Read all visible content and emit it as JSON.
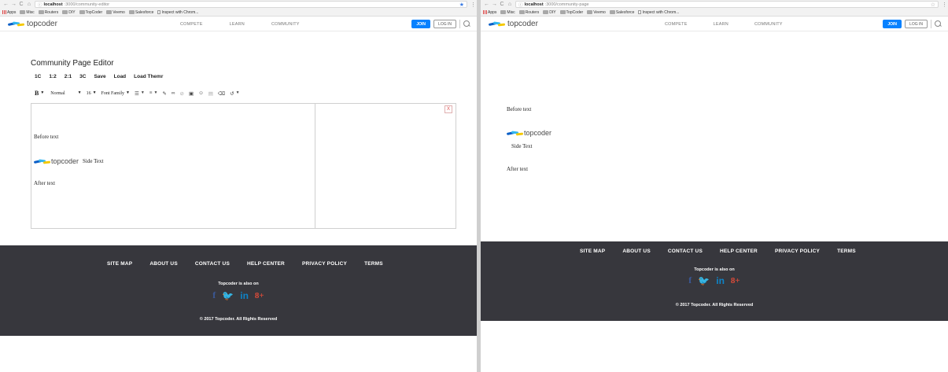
{
  "bookmarks": [
    "Apps",
    "Misc",
    "Routers",
    "DIY",
    "TopCoder",
    "Veemo",
    "Salesforce",
    "Inspect with Chrom..."
  ],
  "site": {
    "logo_text": "topcoder",
    "nav": [
      "COMPETE",
      "LEARN",
      "COMMUNITY"
    ],
    "join": "JOIN",
    "login": "LOG IN"
  },
  "left": {
    "url_host": "localhost",
    "url_path": ":3000/community-editor",
    "editor_title": "Community Page Editor",
    "layout_buttons": [
      "1C",
      "1:2",
      "2:1",
      "3C",
      "Save",
      "Load",
      "Load Themr"
    ],
    "format": {
      "bold": "B",
      "block_type": "Normal",
      "font_size": "16",
      "font_family": "Font Family"
    },
    "close_label": "X",
    "content": {
      "before": "Before text",
      "logo_text": "topcoder",
      "side": "Side Text",
      "after": "After text"
    }
  },
  "right": {
    "url_host": "localhost",
    "url_path": ":3000/community-page",
    "content": {
      "before": "Before text",
      "logo_text": "topcoder",
      "side": "Side Text",
      "after": "After text"
    }
  },
  "footer": {
    "links": [
      "SITE MAP",
      "ABOUT US",
      "CONTACT US",
      "HELP CENTER",
      "PRIVACY POLICY",
      "TERMS"
    ],
    "also_on": "Topcoder is also on",
    "social": [
      "f",
      "🐦",
      "in",
      "8+"
    ],
    "copyright": "© 2017 Topcoder. All Rights Reserved"
  },
  "colors": {
    "accent": "#0681ff",
    "footer_bg": "#37373d",
    "facebook": "#3b5998",
    "twitter": "#1da1f2",
    "linkedin": "#0e84c8",
    "googleplus": "#dd4b39"
  }
}
